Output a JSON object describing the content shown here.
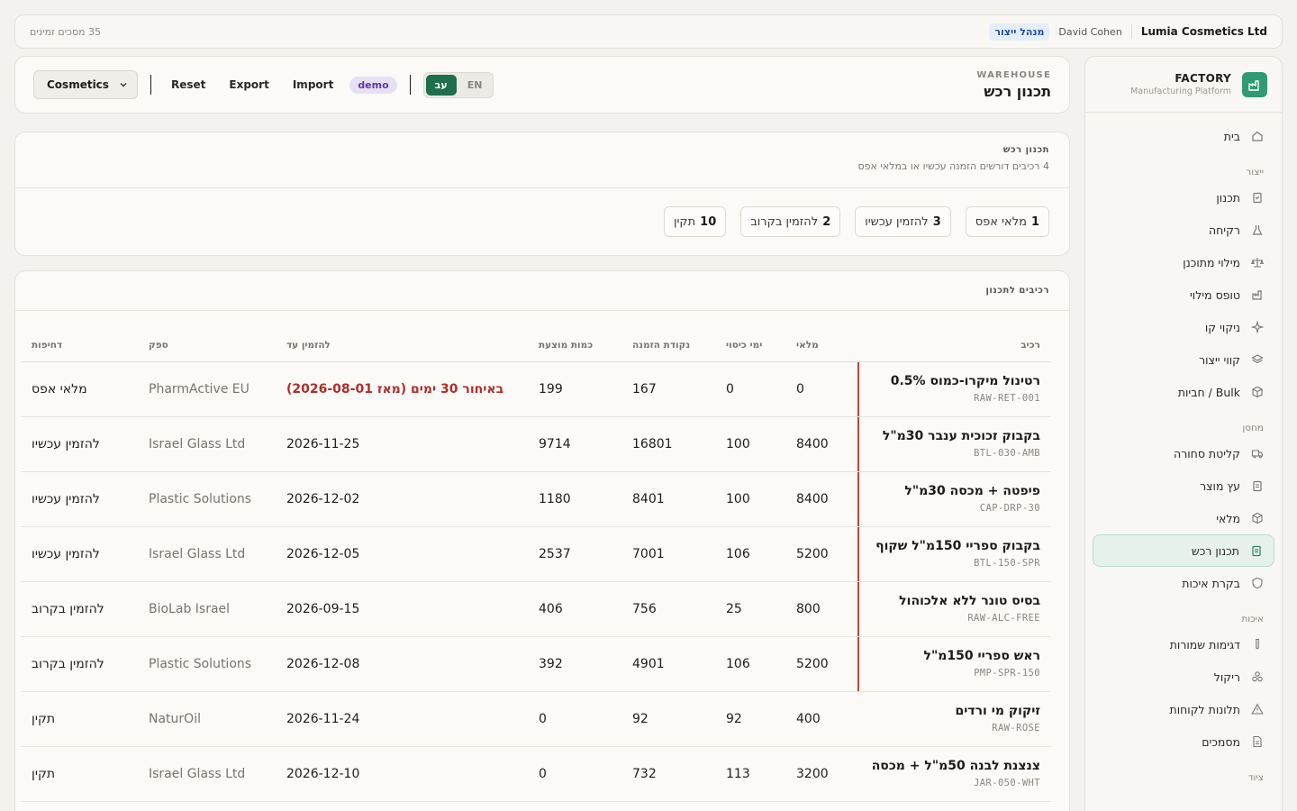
{
  "topbar": {
    "company": "Lumia Cosmetics Ltd",
    "user": "David Cohen",
    "role": "מנהל ייצור",
    "screens": "35 מסכים זמינים"
  },
  "brand": {
    "title": "FACTORY",
    "subtitle": "Manufacturing Platform"
  },
  "nav": {
    "home": "בית",
    "sections": {
      "production": "ייצור",
      "warehouse": "מחסן",
      "quality": "איכות",
      "equipment": "ציוד"
    },
    "items": {
      "planning": "תכנון",
      "mixing": "רקיחה",
      "planned_filling": "מילוי מתוכנן",
      "filling_form": "טופס מילוי",
      "cip": "ניקוי קו",
      "production_lines": "קווי ייצור",
      "bulk": "Bulk / חביות",
      "receiving": "קליטת סחורה",
      "product_tree": "עץ מוצר",
      "inventory": "מלאי",
      "procurement_planning": "תכנון רכש",
      "quality_control": "בקרת איכות",
      "retained_samples": "דגימות שמורות",
      "recall": "ריקול",
      "complaints": "תלונות לקוחות",
      "documents": "מסמכים"
    }
  },
  "header": {
    "kicker": "WAREHOUSE",
    "title": "תכנון רכש",
    "category_select": "Cosmetics",
    "reset": "Reset",
    "export": "Export",
    "import": "Import",
    "demo_badge": "demo",
    "lang_he": "עב",
    "lang_en": "EN"
  },
  "summary": {
    "title": "תכנון רכש",
    "subtitle": "4 רכיבים דורשים הזמנה עכשיו או במלאי אפס",
    "chips": [
      {
        "count": "1",
        "label": "מלאי אפס"
      },
      {
        "count": "3",
        "label": "להזמין עכשיו"
      },
      {
        "count": "2",
        "label": "להזמין בקרוב"
      },
      {
        "count": "10",
        "label": "תקין"
      }
    ]
  },
  "table": {
    "title": "רכיבים לתכנון",
    "columns": [
      "רכיב",
      "מלאי",
      "ימי כיסוי",
      "נקודת הזמנה",
      "כמות מוצעת",
      "להזמין עד",
      "ספק",
      "דחיפות"
    ],
    "rows": [
      {
        "name": "רטינול מיקרו-כמוס 0.5%",
        "sku": "RAW-RET-001",
        "stock": "0",
        "days": "0",
        "reorder": "167",
        "qty": "199",
        "order_by": "באיחור 30 ימים (מאז 2026-08-01)",
        "supplier": "PharmActive EU",
        "urgency": "מלאי אפס"
      },
      {
        "name": "בקבוק זכוכית ענבר 30מ\"ל",
        "sku": "BTL-030-AMB",
        "stock": "8400",
        "days": "100",
        "reorder": "16801",
        "qty": "9714",
        "order_by": "2026-11-25",
        "supplier": "Israel Glass Ltd",
        "urgency": "להזמין עכשיו"
      },
      {
        "name": "פיפטה + מכסה 30מ\"ל",
        "sku": "CAP-DRP-30",
        "stock": "8400",
        "days": "100",
        "reorder": "8401",
        "qty": "1180",
        "order_by": "2026-12-02",
        "supplier": "Plastic Solutions",
        "urgency": "להזמין עכשיו"
      },
      {
        "name": "בקבוק ספריי 150מ\"ל שקוף",
        "sku": "BTL-150-SPR",
        "stock": "5200",
        "days": "106",
        "reorder": "7001",
        "qty": "2537",
        "order_by": "2026-12-05",
        "supplier": "Israel Glass Ltd",
        "urgency": "להזמין עכשיו"
      },
      {
        "name": "בסיס טונר ללא אלכוהול",
        "sku": "RAW-ALC-FREE",
        "stock": "800",
        "days": "25",
        "reorder": "756",
        "qty": "406",
        "order_by": "2026-09-15",
        "supplier": "BioLab Israel",
        "urgency": "להזמין בקרוב"
      },
      {
        "name": "ראש ספריי 150מ\"ל",
        "sku": "PMP-SPR-150",
        "stock": "5200",
        "days": "106",
        "reorder": "4901",
        "qty": "392",
        "order_by": "2026-12-08",
        "supplier": "Plastic Solutions",
        "urgency": "להזמין בקרוב"
      },
      {
        "name": "זיקוק מי ורדים",
        "sku": "RAW-ROSE",
        "stock": "400",
        "days": "92",
        "reorder": "92",
        "qty": "0",
        "order_by": "2026-11-24",
        "supplier": "NaturOil",
        "urgency": "תקין"
      },
      {
        "name": "צנצנת לבנה 50מ\"ל + מכסה",
        "sku": "JAR-050-WHT",
        "stock": "3200",
        "days": "113",
        "reorder": "732",
        "qty": "0",
        "order_by": "2026-12-10",
        "supplier": "Israel Glass Ltd",
        "urgency": "תקין"
      }
    ]
  }
}
